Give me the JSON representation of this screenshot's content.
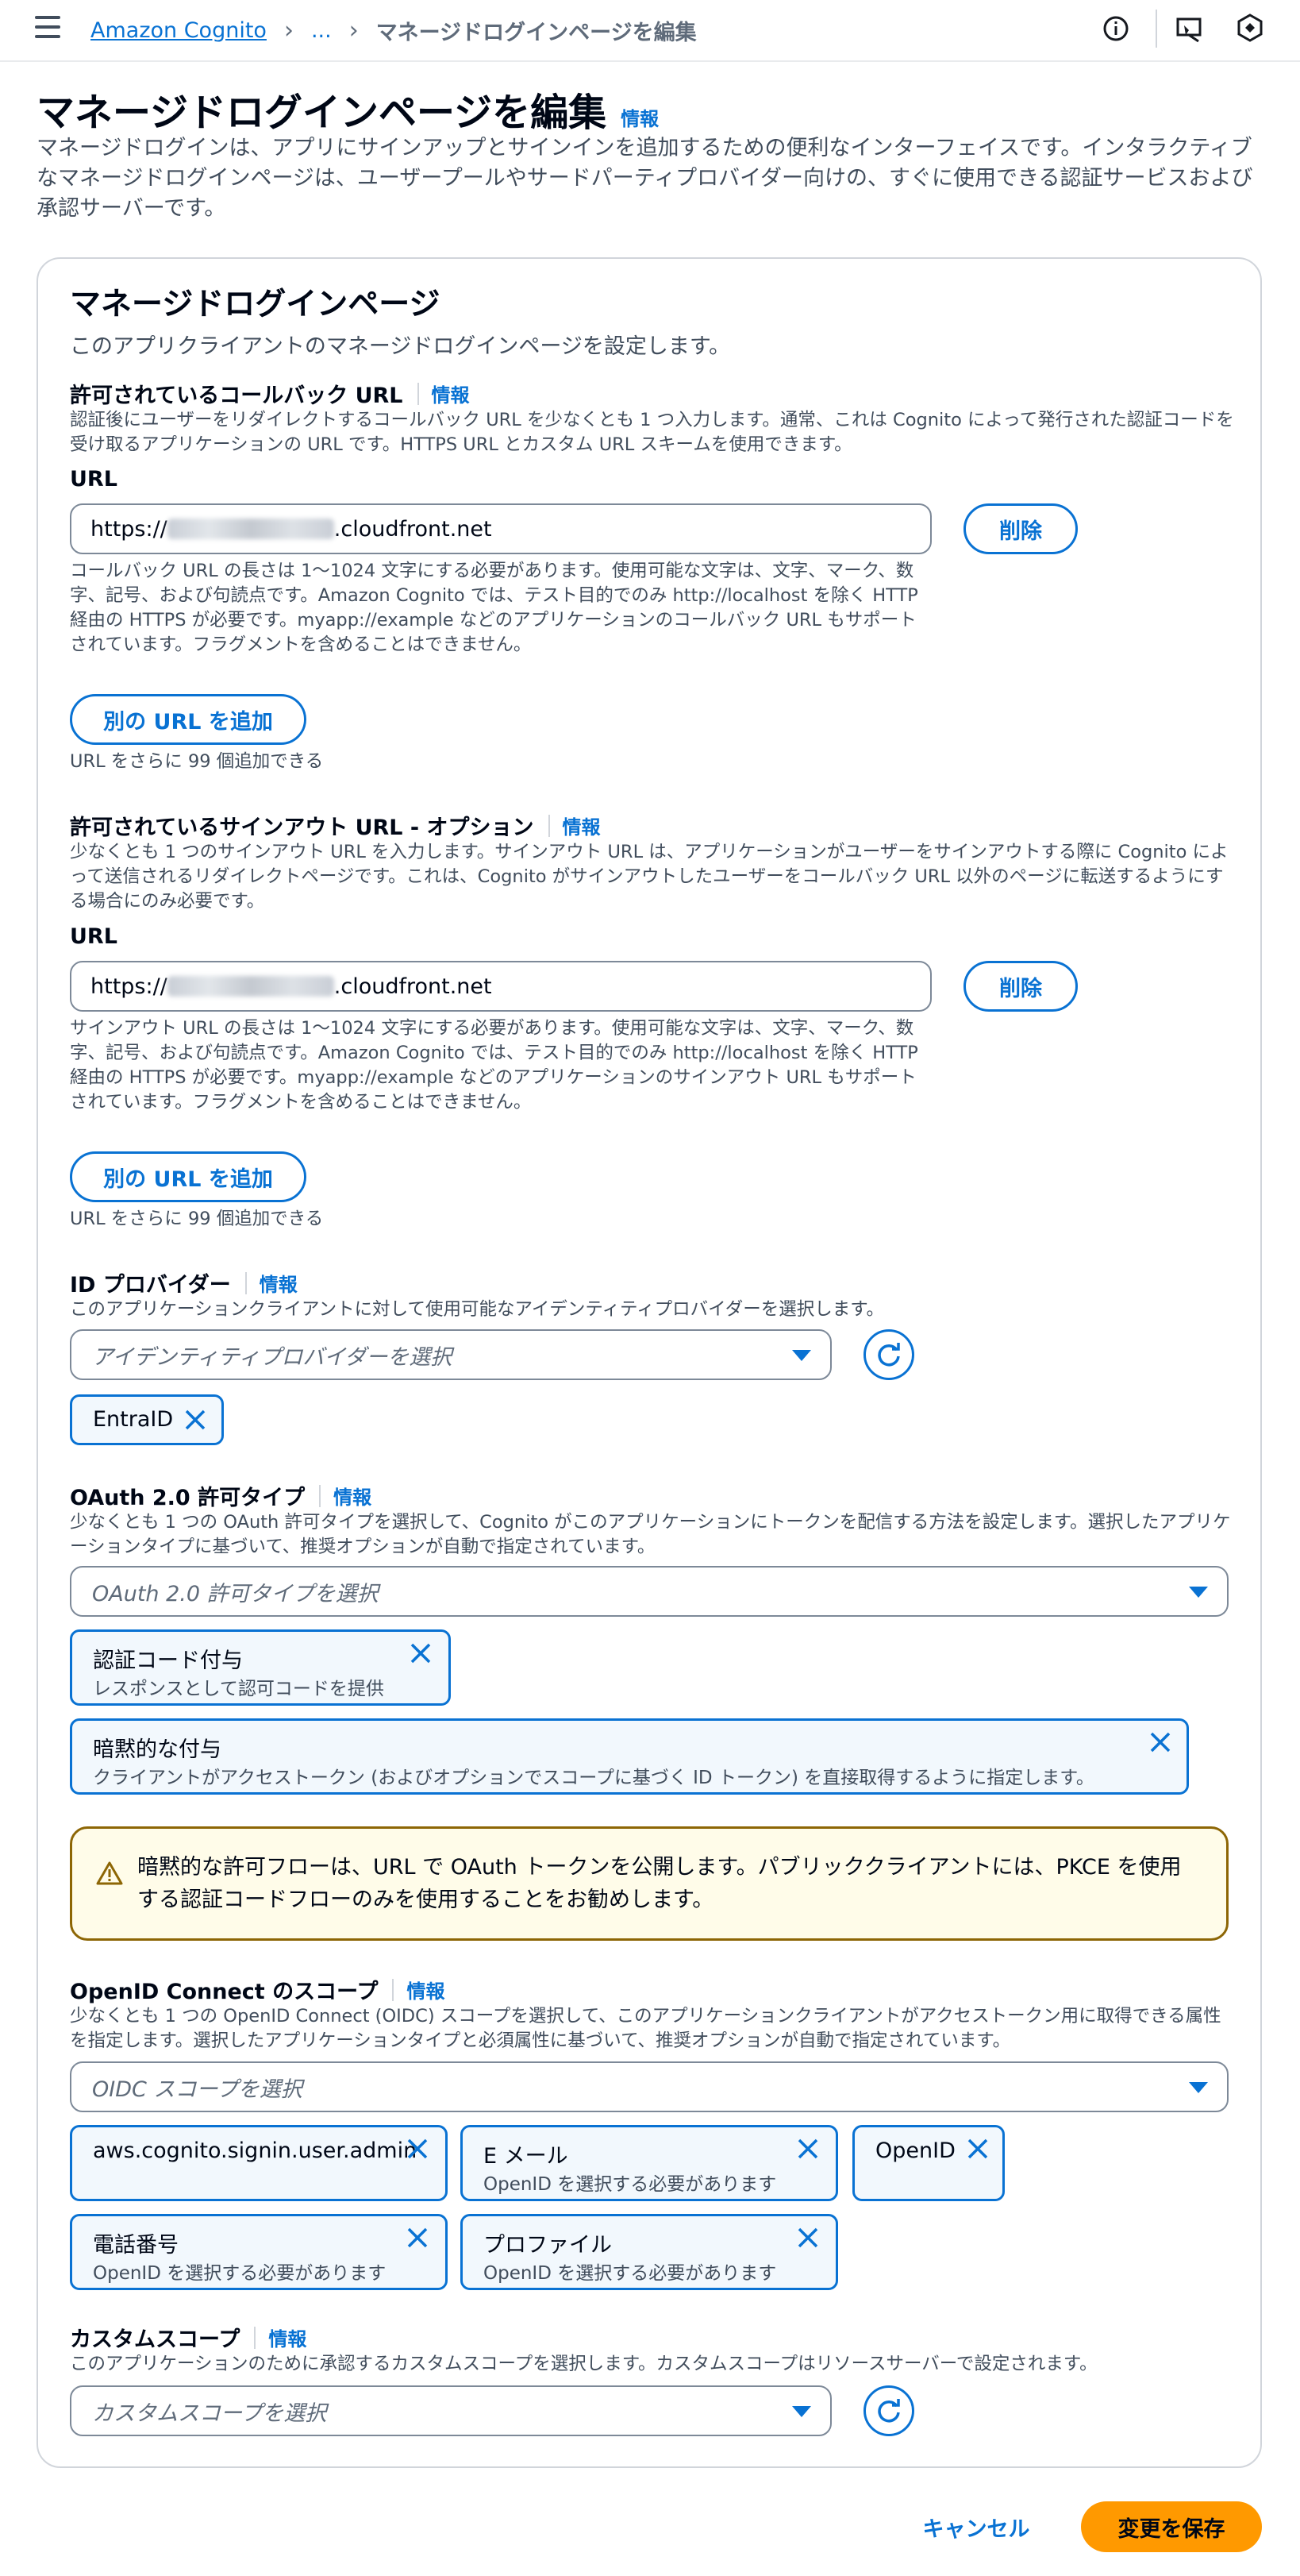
{
  "topbar": {
    "breadcrumb_root": "Amazon Cognito",
    "breadcrumb_ellipsis": "...",
    "breadcrumb_current": "マネージドログインページを編集"
  },
  "header": {
    "title": "マネージドログインページを編集",
    "info": "情報",
    "description": "マネージドログインは、アプリにサインアップとサインインを追加するための便利なインターフェイスです。インタラクティブなマネージドログインページは、ユーザープールやサードパーティプロバイダー向けの、すぐに使用できる認証サービスおよび承認サーバーです。"
  },
  "panel": {
    "title": "マネージドログインページ",
    "subtitle": "このアプリクライアントのマネージドログインページを設定します。"
  },
  "callback": {
    "title": "許可されているコールバック URL",
    "info": "情報",
    "description": "認証後にユーザーをリダイレクトするコールバック URL を少なくとも 1 つ入力します。通常、これは Cognito によって発行された認証コードを受け取るアプリケーションの URL です。HTTPS URL とカスタム URL スキームを使用できます。",
    "url_label": "URL",
    "url_prefix": "https://",
    "url_suffix": ".cloudfront.net",
    "delete_label": "削除",
    "constraint": "コールバック URL の長さは 1～1024 文字にする必要があります。使用可能な文字は、文字、マーク、数字、記号、および句読点です。Amazon Cognito では、テスト目的でのみ http://localhost を除く HTTP 経由の HTTPS が必要です。myapp://example などのアプリケーションのコールバック URL もサポートされています。フラグメントを含めることはできません。",
    "add_label": "別の URL を追加",
    "remaining": "URL をさらに 99 個追加できる"
  },
  "signout": {
    "title": "許可されているサインアウト URL - オプション",
    "info": "情報",
    "description": "少なくとも 1 つのサインアウト URL を入力します。サインアウト URL は、アプリケーションがユーザーをサインアウトする際に Cognito によって送信されるリダイレクトページです。これは、Cognito がサインアウトしたユーザーをコールバック URL 以外のページに転送するようにする場合にのみ必要です。",
    "url_label": "URL",
    "url_prefix": "https://",
    "url_suffix": ".cloudfront.net",
    "delete_label": "削除",
    "constraint": "サインアウト URL の長さは 1～1024 文字にする必要があります。使用可能な文字は、文字、マーク、数字、記号、および句読点です。Amazon Cognito では、テスト目的でのみ http://localhost を除く HTTP 経由の HTTPS が必要です。myapp://example などのアプリケーションのサインアウト URL もサポートされています。フラグメントを含めることはできません。",
    "add_label": "別の URL を追加",
    "remaining": "URL をさらに 99 個追加できる"
  },
  "idp": {
    "title": "ID プロバイダー",
    "info": "情報",
    "description": "このアプリケーションクライアントに対して使用可能なアイデンティティプロバイダーを選択します。",
    "placeholder": "アイデンティティプロバイダーを選択",
    "tokens": [
      {
        "label": "EntraID"
      }
    ]
  },
  "oauth": {
    "title": "OAuth 2.0 許可タイプ",
    "info": "情報",
    "description": "少なくとも 1 つの OAuth 許可タイプを選択して、Cognito がこのアプリケーションにトークンを配信する方法を設定します。選択したアプリケーションタイプに基づいて、推奨オプションが自動で指定されています。",
    "placeholder": "OAuth 2.0 許可タイプを選択",
    "tokens": [
      {
        "label": "認証コード付与",
        "sub": "レスポンスとして認可コードを提供"
      },
      {
        "label": "暗黙的な付与",
        "sub": "クライアントがアクセストークン (およびオプションでスコープに基づく ID トークン) を直接取得するように指定します。"
      }
    ],
    "warning": "暗黙的な許可フローは、URL で OAuth トークンを公開します。パブリッククライアントには、PKCE を使用する認証コードフローのみを使用することをお勧めします。"
  },
  "oidc": {
    "title": "OpenID Connect のスコープ",
    "info": "情報",
    "description": "少なくとも 1 つの OpenID Connect (OIDC) スコープを選択して、このアプリケーションクライアントがアクセストークン用に取得できる属性を指定します。選択したアプリケーションタイプと必須属性に基づいて、推奨オプションが自動で指定されています。",
    "placeholder": "OIDC スコープを選択",
    "tokens": [
      {
        "label": "aws.cognito.signin.user.admin",
        "sub": ""
      },
      {
        "label": "E メール",
        "sub": "OpenID を選択する必要があります"
      },
      {
        "label": "OpenID",
        "sub": ""
      },
      {
        "label": "電話番号",
        "sub": "OpenID を選択する必要があります"
      },
      {
        "label": "プロファイル",
        "sub": "OpenID を選択する必要があります"
      }
    ]
  },
  "custom": {
    "title": "カスタムスコープ",
    "info": "情報",
    "description": "このアプリケーションのために承認するカスタムスコープを選択します。カスタムスコープはリソースサーバーで設定されます。",
    "placeholder": "カスタムスコープを選択"
  },
  "footer": {
    "cancel_label": "キャンセル",
    "save_label": "変更を保存"
  },
  "colors": {
    "accent": "#0972d3",
    "primary_button": "#ff9900",
    "warning_border": "#8d6605",
    "warning_bg": "#fffce9"
  }
}
